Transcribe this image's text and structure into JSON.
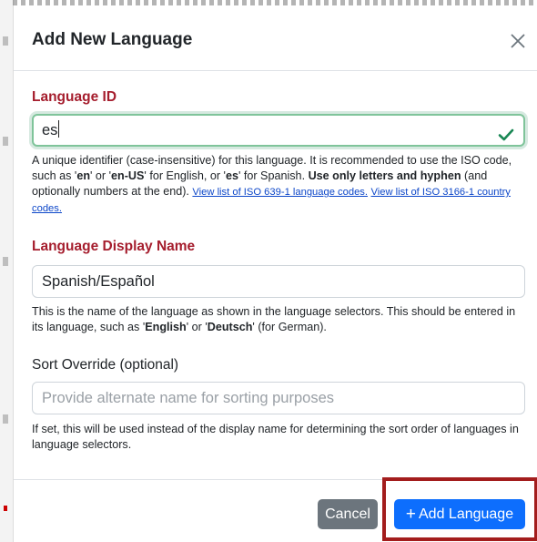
{
  "dialog": {
    "title": "Add New Language",
    "close_icon": "close-icon"
  },
  "language_id": {
    "label": "Language ID",
    "value": "es",
    "valid_icon": "check-icon",
    "help": {
      "t1": "A unique identifier (case-insensitive) for this language. It is recommended to use the ISO code, such as '",
      "b1": "en",
      "t2": "' or '",
      "b2": "en-US",
      "t3": "' for English, or '",
      "b3": "es",
      "t4": "' for Spanish. ",
      "b4": "Use only letters and hyphen",
      "t5": " (and optionally numbers at the end). ",
      "link1": "View list of ISO 639-1 language codes.",
      "link2": "View list of ISO 3166-1 country codes."
    }
  },
  "display_name": {
    "label": "Language Display Name",
    "value": "Spanish/Español",
    "help": {
      "t1": "This is the name of the language as shown in the language selectors. This should be entered in its language, such as '",
      "b1": "English",
      "t2": "' or '",
      "b2": "Deutsch",
      "t3": "' (for German)."
    }
  },
  "sort_override": {
    "label": "Sort Override (optional)",
    "placeholder": "Provide alternate name for sorting purposes",
    "help": "If set, this will be used instead of the display name for determining the sort order of languages in language selectors."
  },
  "footer": {
    "cancel_label": "Cancel",
    "add_label": "Add Language",
    "add_icon": "plus-icon"
  },
  "colors": {
    "required_label": "#a51d2d",
    "primary": "#0d6efd",
    "secondary": "#6c757d",
    "valid": "#198754",
    "highlight_box": "#a31d1d"
  }
}
